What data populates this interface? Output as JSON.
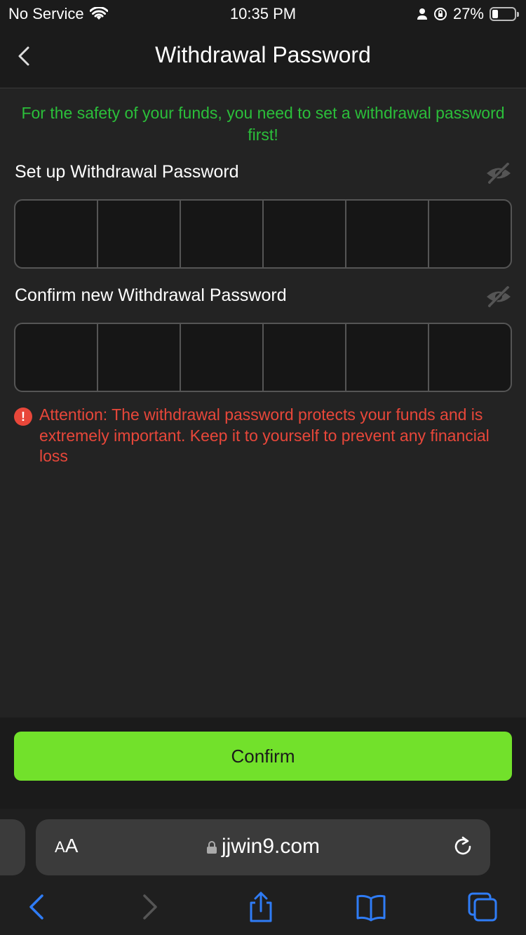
{
  "status_bar": {
    "carrier": "No Service",
    "time": "10:35 PM",
    "battery_percent": "27%",
    "battery_level": 0.27
  },
  "header": {
    "title": "Withdrawal Password"
  },
  "notice": "For the safety of your funds, you need to set a withdrawal password first!",
  "fields": {
    "setup_label": "Set up Withdrawal Password",
    "confirm_label": "Confirm new Withdrawal Password",
    "pin_length": 6
  },
  "warning": {
    "icon": "!",
    "text": "Attention: The withdrawal password protects your funds and is extremely important. Keep it to yourself to prevent any financial loss"
  },
  "confirm_button": "Confirm",
  "safari": {
    "aa_large": "A",
    "aa_small": "A",
    "url": "jjwin9.com"
  },
  "colors": {
    "notice_green": "#2bbf3a",
    "warning_red": "#e8473a",
    "confirm_green": "#72e12b",
    "safari_blue": "#2f7cf6"
  }
}
